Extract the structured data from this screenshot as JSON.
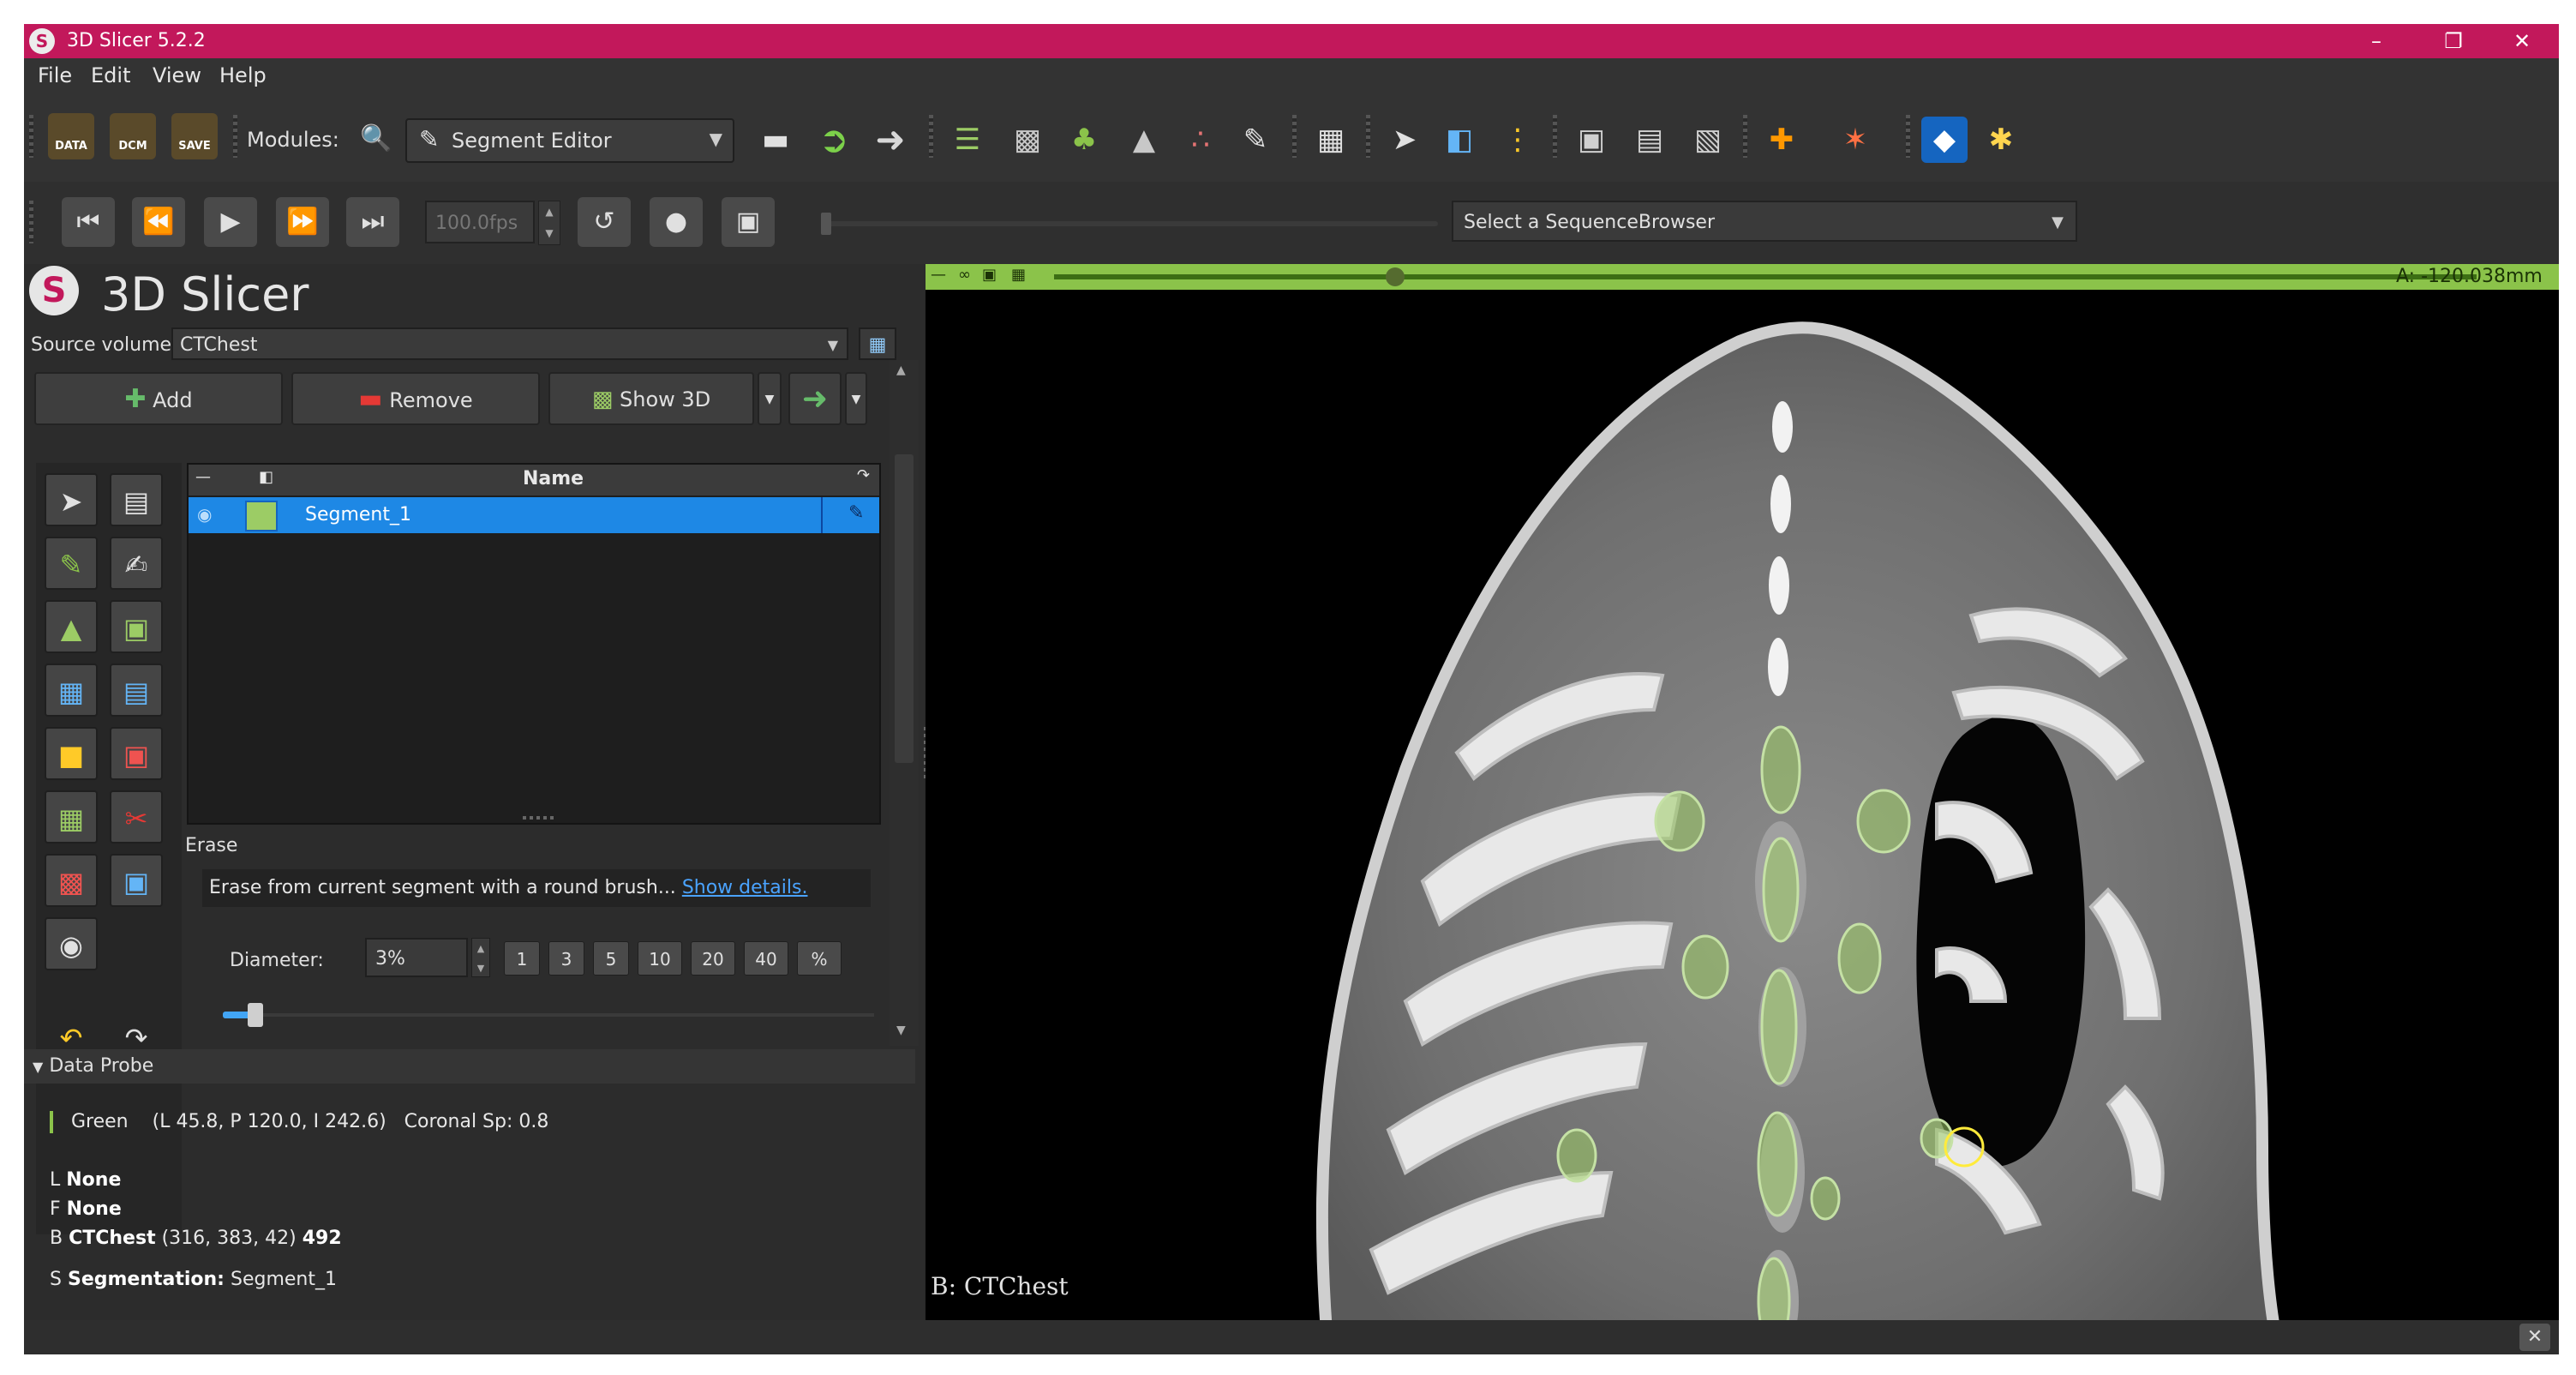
{
  "window": {
    "title": "3D Slicer 5.2.2",
    "controls": {
      "minimize": "–",
      "maximize": "❐",
      "close": "✕"
    }
  },
  "menu": [
    "File",
    "Edit",
    "View",
    "Help"
  ],
  "toolbar": {
    "data_label": "DATA",
    "dcm_label": "DCM",
    "save_label": "SAVE",
    "modules_label": "Modules:",
    "module_selected": "Segment Editor"
  },
  "sequence_toolbar": {
    "fps": "100.0fps",
    "browser_placeholder": "Select a SequenceBrowser"
  },
  "panel": {
    "brand": "3D Slicer",
    "source_volume_label": "Source volume:",
    "source_volume_value": "CTChest",
    "add_label": "Add",
    "remove_label": "Remove",
    "show3d_label": "Show 3D",
    "table_header_name": "Name",
    "segment_name": "Segment_1",
    "effect_name": "Erase",
    "effect_description": "Erase from current segment with a round brush...",
    "show_details": "Show details.",
    "diameter_label": "Diameter:",
    "diameter_value": "3%",
    "diameter_presets": [
      "1",
      "3",
      "5",
      "10",
      "20",
      "40",
      "%"
    ],
    "diameter_fraction": 0.05
  },
  "data_probe": {
    "header": "Data Probe",
    "view_name": "Green",
    "view_coords": "(L 45.8, P 120.0, I 242.6)",
    "view_info": "Coronal Sp: 0.8",
    "l_prefix": "L",
    "l_value": "None",
    "f_prefix": "F",
    "f_value": "None",
    "b_prefix": "B",
    "b_volume": "CTChest",
    "b_ijk": "(316, 383, 42)",
    "b_value": "492",
    "s_prefix": "S",
    "s_label": "Segmentation:",
    "s_value": "Segment_1"
  },
  "viewer": {
    "slice_offset": "A: -120.038mm",
    "slice_position_fraction": 0.24,
    "volume_label": "B: CTChest"
  },
  "colors": {
    "titlebar": "#c2185b",
    "selection": "#1e88e5",
    "green_slice": "#8bc34a",
    "segment": "#9ccc65"
  }
}
